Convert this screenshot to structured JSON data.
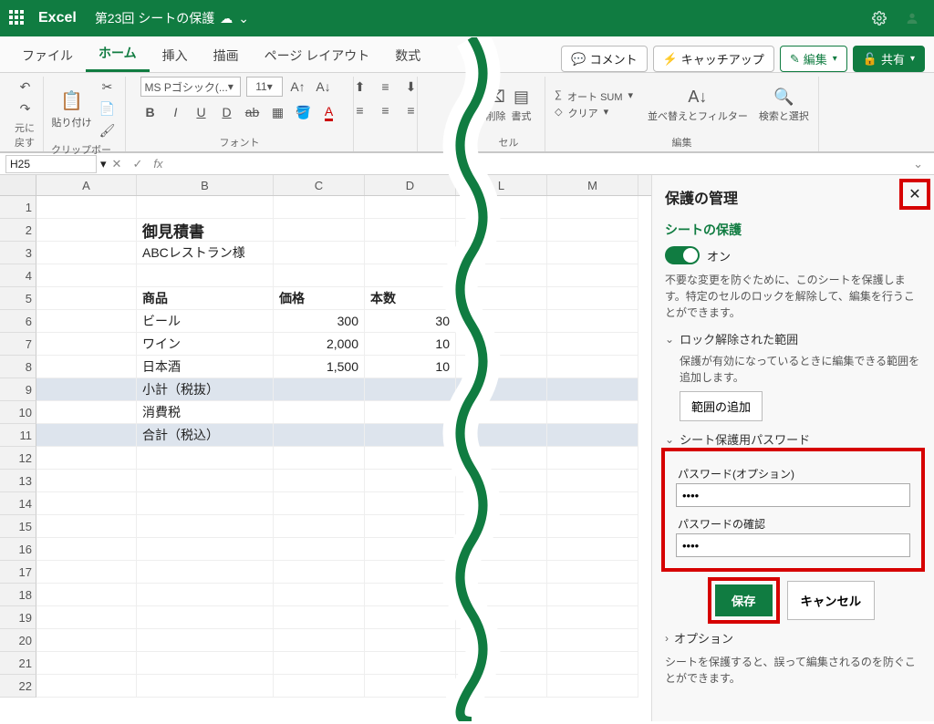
{
  "title": {
    "app": "Excel",
    "doc": "第23回 シートの保護"
  },
  "tabs": {
    "file": "ファイル",
    "home": "ホーム",
    "insert": "挿入",
    "draw": "描画",
    "layout": "ページ レイアウト",
    "formulas": "数式"
  },
  "actions": {
    "comment": "コメント",
    "catchup": "キャッチアップ",
    "edit": "編集",
    "share": "共有"
  },
  "ribbon": {
    "undo": "元に戻す",
    "clipboard": "クリップボード",
    "paste": "貼り付け",
    "font_group": "フォント",
    "font_name": "MS Pゴシック(...",
    "font_size": "11",
    "cells": "セル",
    "delete": "削除",
    "format": "書式",
    "editing": "編集",
    "autosum": "オート SUM",
    "clear": "クリア",
    "sortfilter": "並べ替えとフィルター",
    "findselect": "検索と選択"
  },
  "fx": {
    "namebox": "H25"
  },
  "cols": {
    "A": "A",
    "B": "B",
    "C": "C",
    "D": "D",
    "L": "L",
    "M": "M"
  },
  "grid": {
    "r2b": "御見積書",
    "r3b": "ABCレストラン様",
    "r5b": "商品",
    "r5c": "価格",
    "r5d": "本数",
    "r6b": "ビール",
    "r6c": "300",
    "r6d": "30",
    "r7b": "ワイン",
    "r7c": "2,000",
    "r7d": "10",
    "r8b": "日本酒",
    "r8c": "1,500",
    "r8d": "10",
    "r9b": "小計（税抜）",
    "r10b": "消費税",
    "r11b": "合計（税込）"
  },
  "pane": {
    "title": "保護の管理",
    "sheet_protect": "シートの保護",
    "on": "オン",
    "desc": "不要な変更を防ぐために、このシートを保護します。特定のセルのロックを解除して、編集を行うことができます。",
    "unlocked": "ロック解除された範囲",
    "unlocked_hint": "保護が有効になっているときに編集できる範囲を追加します。",
    "add_range": "範囲の追加",
    "pwd_section": "シート保護用パスワード",
    "pwd_label": "パスワード(オプション)",
    "pwd_value": "••••",
    "pwd_confirm": "パスワードの確認",
    "pwd_confirm_value": "••••",
    "save": "保存",
    "cancel": "キャンセル",
    "options": "オプション",
    "footer": "シートを保護すると、誤って編集されるのを防ぐことができます。"
  }
}
